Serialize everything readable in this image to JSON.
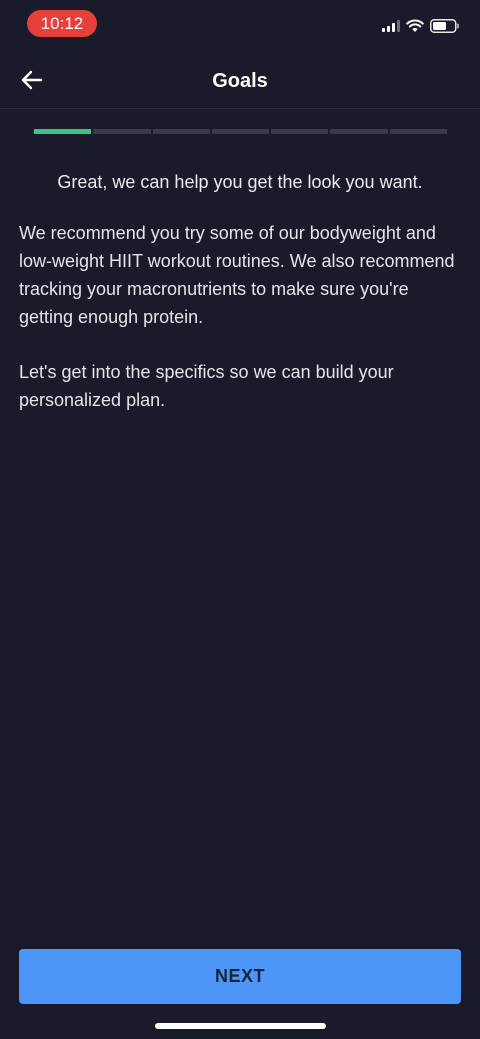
{
  "status_bar": {
    "time": "10:12",
    "icons": [
      "cellular-signal-icon",
      "wifi-icon",
      "battery-icon"
    ]
  },
  "nav": {
    "back_icon": "arrow-left-icon",
    "title": "Goals"
  },
  "progress": {
    "current_step": 1,
    "total_steps": 7,
    "active_color": "#3ec28a"
  },
  "content": {
    "headline": "Great, we can help you get the look you want.",
    "paragraph1": "We recommend you try some of our bodyweight and low-weight HIIT workout routines. We also recommend tracking your macronutrients to make sure you're getting enough protein.",
    "paragraph2": "Let's get into the specifics so we can build your personalized plan."
  },
  "footer": {
    "next_label": "NEXT",
    "button_color": "#4d95f7"
  }
}
